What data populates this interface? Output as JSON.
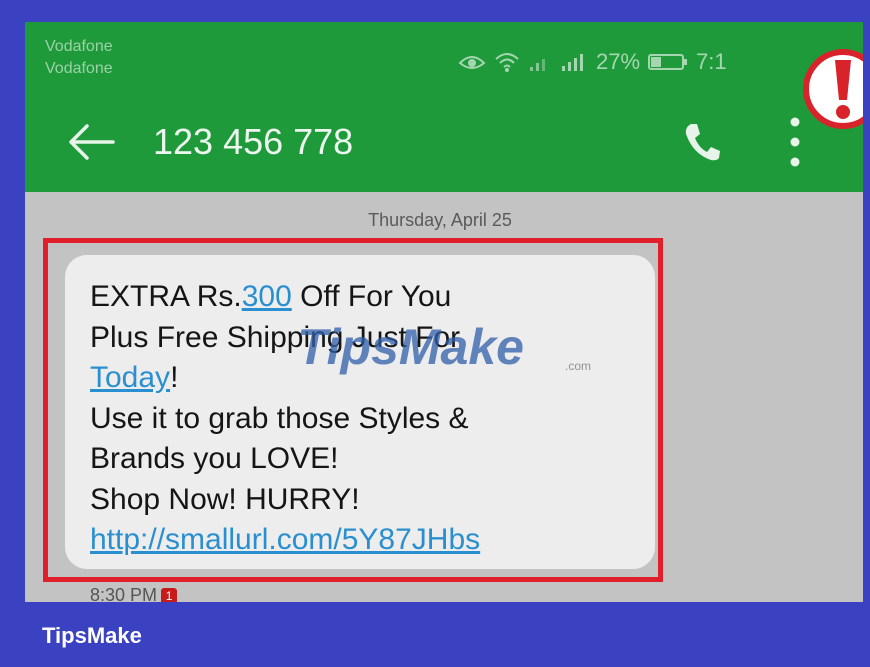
{
  "status_bar": {
    "carrier_1": "Vodafone",
    "carrier_2": "Vodafone",
    "battery": "27%",
    "clock": "7:1"
  },
  "conversation": {
    "contact": "123 456 778",
    "date": "Thursday, April 25",
    "message": {
      "line1_pre": "EXTRA Rs.",
      "line1_link": "300",
      "line1_post": " Off For You",
      "line2": "Plus Free Shipping Just For",
      "line3_link": "Today",
      "line3_post": "!",
      "line4": "Use it to grab those Styles &",
      "line5": "Brands you LOVE!",
      "line6": "Shop Now! HURRY!",
      "url": "http://smallurl.com/5Y87JHbs"
    },
    "time": "8:30 PM",
    "badge": "1"
  },
  "watermark": "TipsMake",
  "watermark_suffix": ".com",
  "brand": "TipsMake",
  "icons": {
    "back": "arrow-left",
    "call": "phone",
    "more": "vertical-dots",
    "alert": "exclamation-circle",
    "eye": "eye",
    "wifi": "wifi",
    "signal": "signal-bars",
    "battery": "battery"
  },
  "colors": {
    "app_bar": "#1f9a3b",
    "frame": "#3a42c2",
    "highlight": "#e01f2a",
    "link": "#2a8fd0",
    "alert": "#d8232a"
  }
}
